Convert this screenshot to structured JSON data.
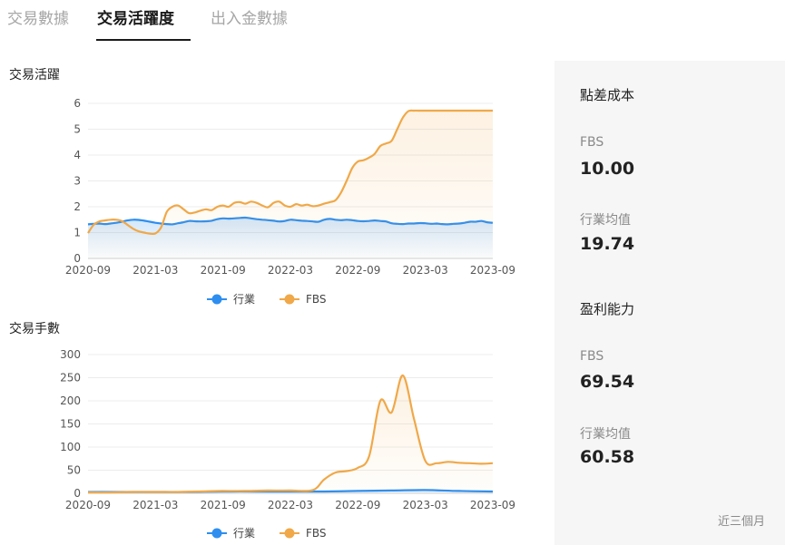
{
  "tabs": [
    {
      "label": "交易數據",
      "active": false
    },
    {
      "label": "交易活躍度",
      "active": true
    },
    {
      "label": "出入金數據",
      "active": false
    }
  ],
  "colors": {
    "industry": "#2d8ef0",
    "fbs": "#f0a848",
    "active_tab": "#1a1a1a"
  },
  "charts": {
    "activity_title": "交易活躍",
    "count_title": "交易手數",
    "legend": {
      "industry": "行業",
      "fbs": "FBS"
    }
  },
  "chart_data": [
    {
      "type": "area",
      "title": "交易活躍",
      "x_ticks": [
        "2020-09",
        "2021-03",
        "2021-09",
        "2022-03",
        "2022-09",
        "2023-03",
        "2023-09"
      ],
      "y_ticks": [
        0,
        1,
        2,
        3,
        4,
        5,
        6
      ],
      "ylim": [
        0,
        6
      ],
      "grid": true,
      "legend_position": "bottom-center",
      "series": [
        {
          "name": "行業",
          "x": [
            0,
            0.5,
            1,
            1.5,
            2,
            2.5,
            3,
            3.5,
            4,
            4.5,
            5,
            5.5,
            6,
            6.5,
            7,
            7.5,
            8,
            8.5,
            9,
            9.5,
            10,
            10.5,
            11,
            11.5,
            12,
            12.5,
            13,
            13.5,
            14,
            14.5,
            15,
            15.5,
            16,
            16.5,
            17,
            17.5,
            18,
            18.5,
            19,
            19.5,
            20,
            20.5,
            21,
            21.5,
            22,
            22.5,
            23,
            23.5,
            24,
            24.5,
            25,
            25.5,
            26,
            26.5,
            27,
            27.5,
            28,
            28.5,
            29,
            29.5,
            30,
            30.5,
            31,
            31.5,
            32,
            32.5,
            33,
            33.5,
            34,
            34.5,
            35,
            35.5,
            36
          ],
          "values": [
            1.32,
            1.34,
            1.35,
            1.33,
            1.35,
            1.38,
            1.42,
            1.47,
            1.5,
            1.49,
            1.46,
            1.42,
            1.38,
            1.35,
            1.33,
            1.32,
            1.36,
            1.4,
            1.45,
            1.44,
            1.43,
            1.44,
            1.46,
            1.52,
            1.55,
            1.54,
            1.55,
            1.57,
            1.58,
            1.55,
            1.52,
            1.5,
            1.48,
            1.46,
            1.43,
            1.45,
            1.5,
            1.48,
            1.46,
            1.45,
            1.43,
            1.42,
            1.5,
            1.53,
            1.5,
            1.48,
            1.5,
            1.48,
            1.45,
            1.44,
            1.45,
            1.47,
            1.45,
            1.43,
            1.36,
            1.34,
            1.33,
            1.35,
            1.35,
            1.37,
            1.36,
            1.34,
            1.35,
            1.33,
            1.32,
            1.34,
            1.35,
            1.38,
            1.42,
            1.42,
            1.45,
            1.4,
            1.38
          ]
        },
        {
          "name": "FBS",
          "x": [
            0,
            0.5,
            1,
            1.5,
            2,
            2.5,
            3,
            3.5,
            4,
            4.5,
            5,
            5.5,
            6,
            6.5,
            7,
            7.5,
            8,
            8.5,
            9,
            9.5,
            10,
            10.5,
            11,
            11.5,
            12,
            12.5,
            13,
            13.5,
            14,
            14.5,
            15,
            15.5,
            16,
            16.5,
            17,
            17.5,
            18,
            18.5,
            19,
            19.5,
            20,
            20.5,
            21,
            21.5,
            22,
            22.5,
            23,
            23.5,
            24,
            24.5,
            25,
            25.5,
            26,
            26.5,
            27,
            27.5,
            28,
            28.5,
            29,
            29.5,
            30,
            30.5,
            31,
            31.5,
            32,
            32.5,
            33,
            33.5,
            34,
            34.5,
            35,
            35.5,
            36
          ],
          "values": [
            0.98,
            1.3,
            1.43,
            1.47,
            1.5,
            1.5,
            1.45,
            1.3,
            1.15,
            1.05,
            1.0,
            0.96,
            0.97,
            1.2,
            1.8,
            2.0,
            2.05,
            1.9,
            1.75,
            1.78,
            1.85,
            1.9,
            1.87,
            2.0,
            2.05,
            2.0,
            2.15,
            2.18,
            2.12,
            2.2,
            2.15,
            2.05,
            1.98,
            2.15,
            2.2,
            2.05,
            2.0,
            2.1,
            2.05,
            2.08,
            2.02,
            2.05,
            2.12,
            2.18,
            2.25,
            2.55,
            3.0,
            3.5,
            3.75,
            3.8,
            3.9,
            4.05,
            4.35,
            4.45,
            4.55,
            5.0,
            5.45,
            5.7,
            5.72,
            5.72,
            5.72,
            5.72,
            5.72,
            5.72,
            5.72,
            5.72,
            5.72,
            5.72,
            5.72,
            5.72,
            5.72,
            5.72,
            5.72
          ]
        }
      ]
    },
    {
      "type": "area",
      "title": "交易手數",
      "x_ticks": [
        "2020-09",
        "2021-03",
        "2021-09",
        "2022-03",
        "2022-09",
        "2023-03",
        "2023-09"
      ],
      "y_ticks": [
        0,
        50,
        100,
        150,
        200,
        250,
        300
      ],
      "ylim": [
        0,
        300
      ],
      "grid": true,
      "legend_position": "bottom-center",
      "series": [
        {
          "name": "行業",
          "x": [
            0,
            3,
            6,
            9,
            12,
            15,
            18,
            21,
            24,
            27,
            30,
            33,
            36
          ],
          "values": [
            3,
            3,
            3,
            3,
            4,
            4,
            4,
            4,
            5,
            6,
            7,
            5,
            4
          ]
        },
        {
          "name": "FBS",
          "x": [
            0,
            2,
            4,
            6,
            8,
            10,
            12,
            14,
            16,
            18,
            20,
            21,
            22,
            23,
            24,
            25,
            26,
            27,
            28,
            29,
            30,
            31,
            32,
            33,
            34,
            35,
            36
          ],
          "values": [
            2,
            2,
            3,
            3,
            3,
            4,
            5,
            5,
            6,
            6,
            7,
            30,
            45,
            48,
            55,
            80,
            200,
            175,
            255,
            160,
            70,
            65,
            68,
            66,
            65,
            64,
            65
          ]
        }
      ]
    }
  ],
  "panel": {
    "spread_cost": {
      "title": "點差成本",
      "fbs_label": "FBS",
      "fbs_value": "10.00",
      "industry_label": "行業均值",
      "industry_value": "19.74"
    },
    "profitability": {
      "title": "盈利能力",
      "fbs_label": "FBS",
      "fbs_value": "69.54",
      "industry_label": "行業均值",
      "industry_value": "60.58"
    },
    "period": "近三個月"
  }
}
